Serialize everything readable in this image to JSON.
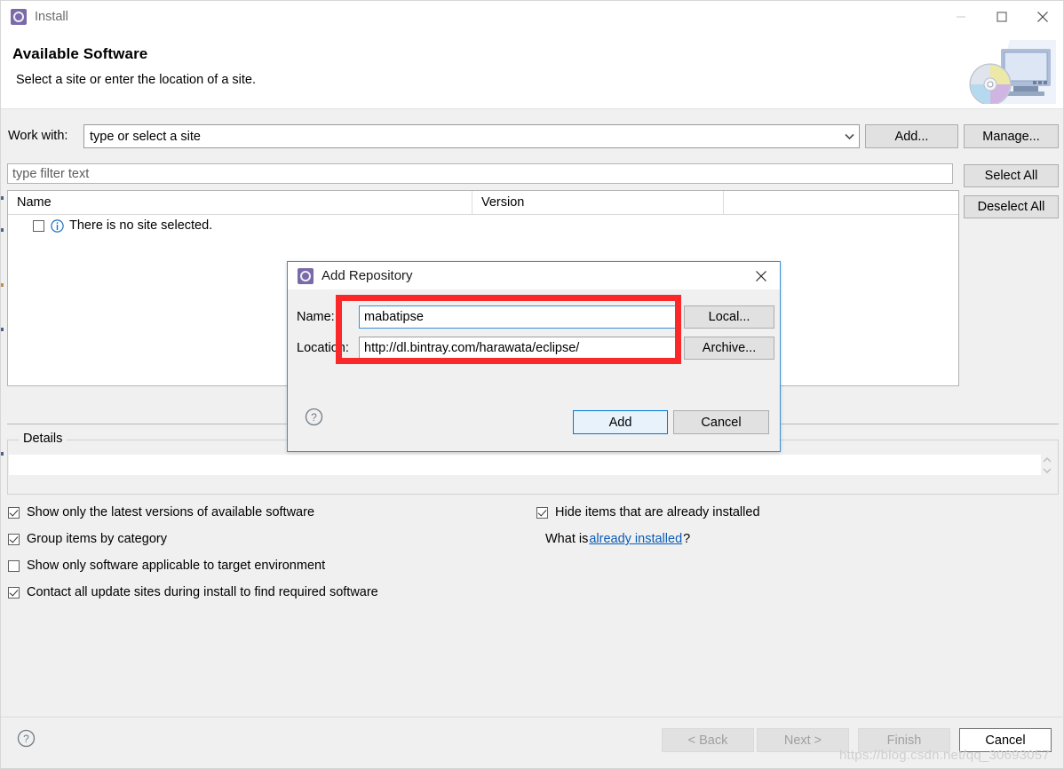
{
  "window": {
    "title": "Install",
    "icon": "eclipse-install-icon",
    "controls": {
      "minimize": "minimize-icon",
      "maximize": "maximize-icon",
      "close": "close-icon"
    }
  },
  "header": {
    "title": "Available Software",
    "subtitle": "Select a site or enter the location of a site.",
    "artwork": "cd-and-monitor-illustration"
  },
  "work_with": {
    "label": "Work with:",
    "value": "type or select a site",
    "placeholder": "type or select a site",
    "dropdown_icon": "chevron-down-icon",
    "add_button": "Add...",
    "manage_button": "Manage..."
  },
  "filter": {
    "placeholder": "type filter text",
    "value": ""
  },
  "side_buttons": {
    "select_all": "Select All",
    "deselect_all": "Deselect All"
  },
  "tree": {
    "columns": [
      "Name",
      "Version",
      ""
    ],
    "rows": [
      {
        "checked": false,
        "icon": "info-icon",
        "name": "There is no site selected.",
        "version": ""
      }
    ]
  },
  "details": {
    "legend": "Details",
    "value": "",
    "spinner_icon": "scroll-spinner-icon"
  },
  "options": [
    {
      "id": "latest-versions",
      "label": "Show only the latest versions of available software",
      "checked": true
    },
    {
      "id": "group-by-category",
      "label": "Group items by category",
      "checked": true
    },
    {
      "id": "target-environment",
      "label": "Show only software applicable to target environment",
      "checked": false
    },
    {
      "id": "contact-all-sites",
      "label": "Contact all update sites during install to find required software",
      "checked": true
    },
    {
      "id": "hide-installed",
      "label": "Hide items that are already installed",
      "checked": true
    }
  ],
  "what_is": {
    "prefix": "What is ",
    "link": "already installed",
    "suffix": "?"
  },
  "footer": {
    "help_icon": "help-icon",
    "back": "< Back",
    "next": "Next >",
    "finish": "Finish",
    "cancel": "Cancel",
    "back_disabled": true,
    "next_disabled": true,
    "finish_disabled": true,
    "cancel_disabled": false
  },
  "dialog": {
    "title": "Add Repository",
    "icon": "eclipse-install-icon",
    "close_icon": "close-icon",
    "name_label": "Name:",
    "name_value": "mabatipse",
    "location_label": "Location:",
    "location_value": "http://dl.bintray.com/harawata/eclipse/",
    "local_button": "Local...",
    "archive_button": "Archive...",
    "add_button": "Add",
    "cancel_button": "Cancel",
    "help_icon": "help-icon"
  },
  "annotation": {
    "highlight_color": "#fa2828",
    "highlight_label": "red-rectangle-highlight"
  },
  "watermark": {
    "text": "https://blog.csdn.net/qq_30693057"
  }
}
